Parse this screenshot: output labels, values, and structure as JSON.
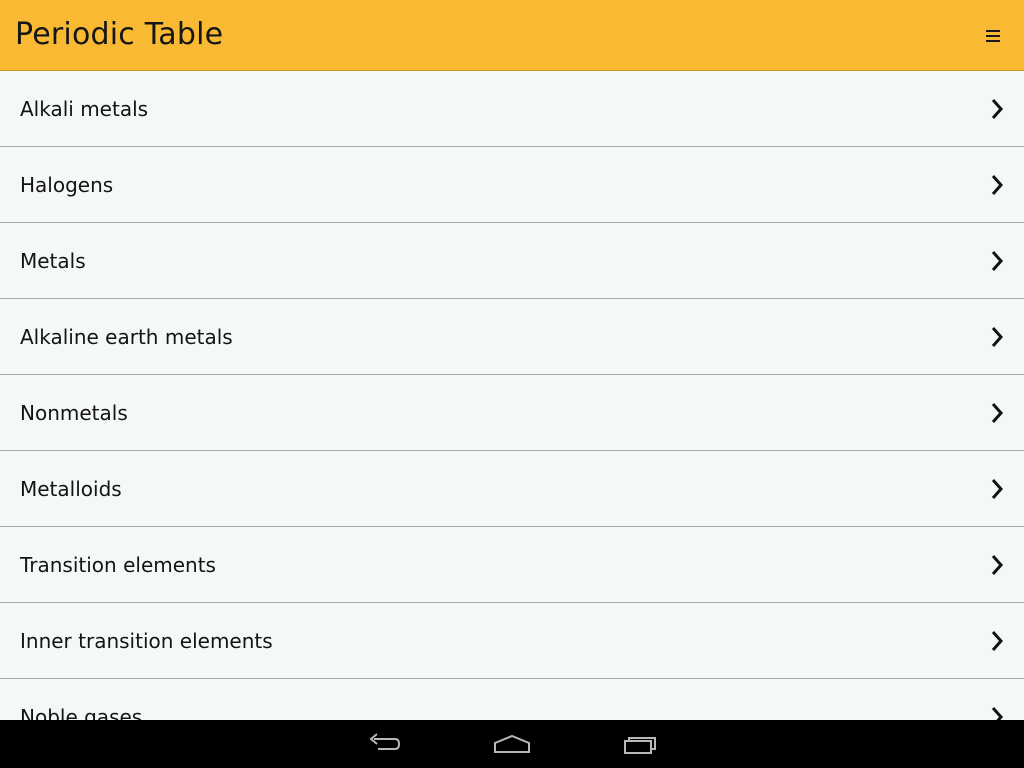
{
  "app_bar": {
    "title": "Periodic Table",
    "background_color": "#f9b933",
    "menu_icon": "menu-icon"
  },
  "categories": [
    {
      "label": "Alkali metals"
    },
    {
      "label": "Halogens"
    },
    {
      "label": "Metals"
    },
    {
      "label": "Alkaline earth metals"
    },
    {
      "label": "Nonmetals"
    },
    {
      "label": "Metalloids"
    },
    {
      "label": "Transition elements"
    },
    {
      "label": "Inner transition elements"
    },
    {
      "label": "Noble gases"
    }
  ],
  "list_item_icon": "chevron-right-icon",
  "system_nav": {
    "buttons": [
      "back-icon",
      "home-icon",
      "recent-apps-icon"
    ]
  }
}
